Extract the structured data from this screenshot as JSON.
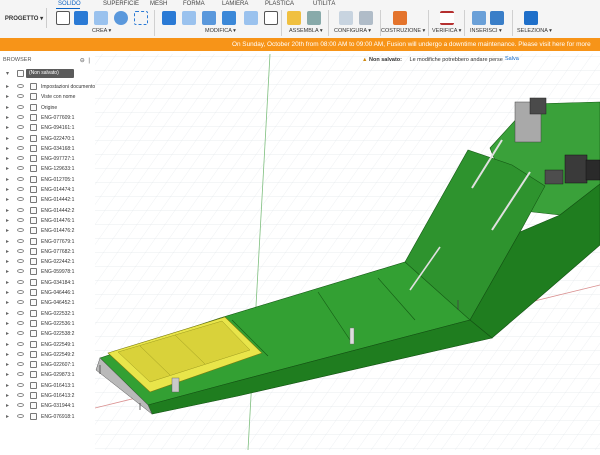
{
  "app": {
    "project_menu": "PROGETTO ▾"
  },
  "tabs": [
    "SOLIDO",
    "SUPERFICIE",
    "MESH",
    "FORMA",
    "LAMIERA",
    "PLASTICA",
    "UTILITÀ"
  ],
  "groups": {
    "crea": "CREA ▾",
    "modifica": "MODIFICA ▾",
    "assembla": "ASSEMBLA ▾",
    "configura": "CONFIGURA ▾",
    "costruzione": "COSTRUZIONE ▾",
    "verifica": "VERIFICA ▾",
    "inserisci": "INSERISCI ▾",
    "seleziona": "SELEZIONA ▾"
  },
  "banner": "On Sunday, October 20th from 08:00 AM to 09:00 AM, Fusion will undergo a downtime maintenance. Please visit here for more",
  "browser": {
    "title": "BROWSER",
    "root": "(Non salvato)",
    "items": [
      "Impostazioni documento",
      "Viste con nome",
      "Origine",
      "ENG-077609:1",
      "ENG-094161:1",
      "ENG-022470:1",
      "ENG-034168:1",
      "ENG-097727:1",
      "ENG-129633:1",
      "ENG-012705:1",
      "ENG-014474:1",
      "ENG-014442:1",
      "ENG-014442:2",
      "ENG-014476:1",
      "ENG-014476:2",
      "ENG-077679:1",
      "ENG-077682:1",
      "ENG-022442:1",
      "ENG-059978:1",
      "ENG-034184:1",
      "ENG-046446:1",
      "ENG-046452:1",
      "ENG-022532:1",
      "ENG-022536:1",
      "ENG-022538:2",
      "ENG-022549:1",
      "ENG-022549:2",
      "ENG-022607:1",
      "ENG-029873:1",
      "ENG-016413:1",
      "ENG-016413:2",
      "ENG-031944:1",
      "ENG-076918:1"
    ]
  },
  "status": {
    "unsaved_label": "Non salvato:",
    "unsaved_message": "Le modifiche potrebbero andare perse",
    "save_button": "Salva"
  },
  "colors": {
    "banner": "#f79418",
    "model_green": "#2f9e2f",
    "model_yellow": "#e8e840",
    "accent": "#0a62c4"
  }
}
